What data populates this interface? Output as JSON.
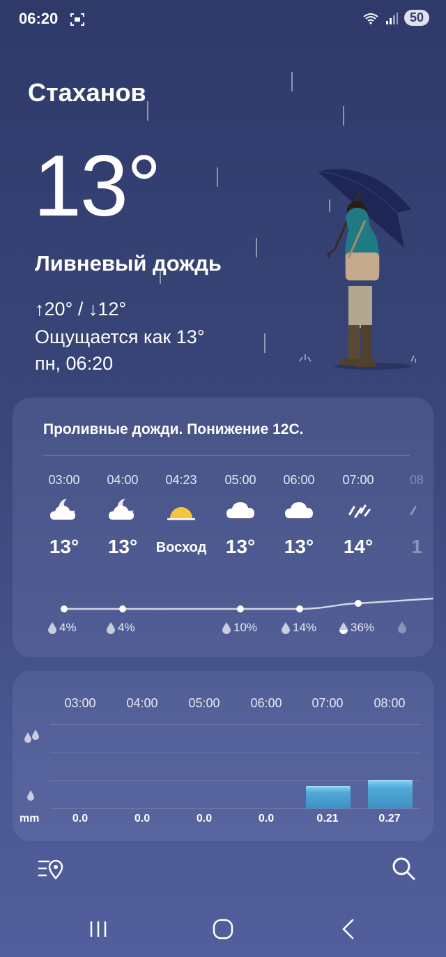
{
  "status": {
    "time": "06:20",
    "battery": "50"
  },
  "location": {
    "city": "Стаханов"
  },
  "current": {
    "temp": "13°",
    "condition": "Ливневый дождь",
    "hilo": "↑20° / ↓12°",
    "feels_like": "Ощущается как 13°",
    "date": "пн, 06:20"
  },
  "hourly": {
    "summary": "Проливные дожди. Понижение 12С.",
    "items": [
      {
        "time": "03:00",
        "icon": "cloud-moon-icon",
        "temp": "13°",
        "precip": "4%"
      },
      {
        "time": "04:00",
        "icon": "cloud-moon-icon",
        "temp": "13°",
        "precip": "4%"
      },
      {
        "time": "04:23",
        "icon": "sunrise-icon",
        "temp": "Восход",
        "precip": ""
      },
      {
        "time": "05:00",
        "icon": "cloud-icon",
        "temp": "13°",
        "precip": "10%"
      },
      {
        "time": "06:00",
        "icon": "cloud-icon",
        "temp": "13°",
        "precip": "14%"
      },
      {
        "time": "07:00",
        "icon": "rain-icon",
        "temp": "14°",
        "precip": "36%"
      }
    ]
  },
  "precipitation": {
    "unit": "mm",
    "times": [
      "03:00",
      "04:00",
      "05:00",
      "06:00",
      "07:00",
      "08:00"
    ],
    "values": [
      "0.0",
      "0.0",
      "0.0",
      "0.0",
      "0.21",
      "0.27"
    ],
    "amounts": [
      0,
      0,
      0,
      0,
      0.21,
      0.27
    ]
  },
  "colors": {
    "accent_bar": "#4fa9d8",
    "background": "#3a4679"
  }
}
